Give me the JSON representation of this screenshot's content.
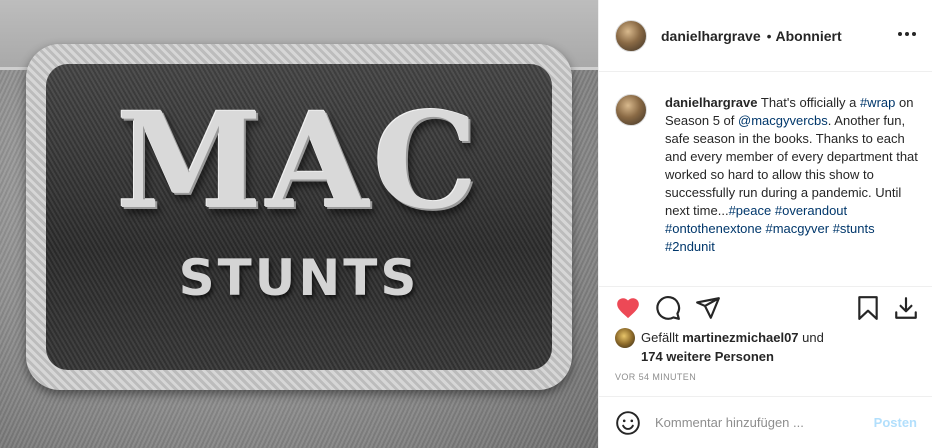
{
  "photo": {
    "patch_title": "MAC",
    "patch_subtitle": "STUNTS"
  },
  "header": {
    "username": "danielhargrave",
    "separator": "•",
    "follow_status": "Abonniert",
    "more_icon": "more-horizontal-icon"
  },
  "caption": {
    "username": "danielhargrave",
    "segments": [
      {
        "type": "text",
        "value": " That's officially a "
      },
      {
        "type": "link",
        "value": "#wrap"
      },
      {
        "type": "text",
        "value": " on Season 5 of "
      },
      {
        "type": "link",
        "value": "@macgyvercbs"
      },
      {
        "type": "text",
        "value": ". Another fun, safe season in the books. Thanks to each and every member of every department that worked so hard to allow this show to successfully run during a pandemic. Until next time..."
      },
      {
        "type": "link",
        "value": "#peace"
      },
      {
        "type": "text",
        "value": " "
      },
      {
        "type": "link",
        "value": "#overandout"
      },
      {
        "type": "text",
        "value": " "
      },
      {
        "type": "link",
        "value": "#ontothenextone"
      },
      {
        "type": "text",
        "value": " "
      },
      {
        "type": "link",
        "value": "#macgyver"
      },
      {
        "type": "text",
        "value": " "
      },
      {
        "type": "link",
        "value": "#stunts"
      },
      {
        "type": "text",
        "value": " "
      },
      {
        "type": "link",
        "value": "#2ndunit"
      }
    ]
  },
  "actions": {
    "icons": [
      "heart-icon",
      "comment-icon",
      "share-icon",
      "bookmark-icon",
      "download-icon"
    ],
    "like_color": "#ed4956"
  },
  "likes": {
    "prefix": "Gefällt",
    "user": "martinezmichael07",
    "conjunction": "und",
    "others": "174 weitere Personen"
  },
  "timestamp": "VOR 54 MINUTEN",
  "comment": {
    "placeholder": "Kommentar hinzufügen ...",
    "post_label": "Posten",
    "emoji_icon": "smiley-icon"
  },
  "colors": {
    "link": "#00376b",
    "post_button": "#b2dffc",
    "muted": "#8e8e8e",
    "text": "#262626"
  }
}
